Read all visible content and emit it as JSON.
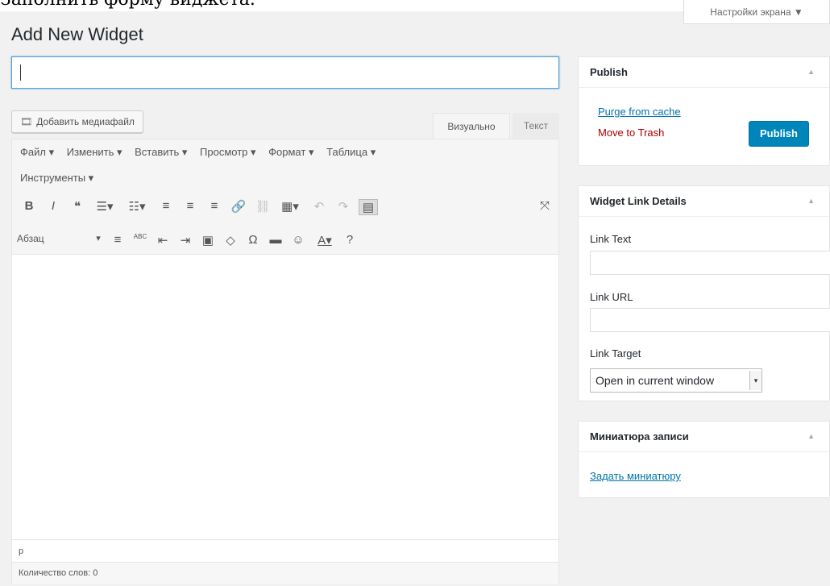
{
  "caption": "Заполнить форму виджета.",
  "screen_options": "Настройки экрана ▼",
  "page_title": "Add New Widget",
  "title_field": {
    "value": "",
    "placeholder": ""
  },
  "media_button": {
    "icon": "media-icon",
    "label": "Добавить медиафайл"
  },
  "editor_tabs": {
    "visual": "Визуально",
    "text": "Текст"
  },
  "menubar": {
    "row1": [
      "Файл ▾",
      "Изменить ▾",
      "Вставить ▾",
      "Просмотр ▾",
      "Формат ▾",
      "Таблица ▾"
    ],
    "row2": [
      "Инструменты ▾"
    ]
  },
  "toolbar1": [
    "B",
    "I",
    "❝",
    "☰▾",
    "☷▾",
    "≡",
    "≡",
    "≡",
    "🔗",
    "⛓",
    "▦▾",
    "↶",
    "↷",
    "▤",
    "⤧"
  ],
  "toolbar2": {
    "format_select": "Абзац",
    "buttons": [
      "▾",
      "≡",
      "ABC",
      "⇤",
      "⇥",
      "▣",
      "◇",
      "Ω",
      "▬",
      "☺",
      "A▾",
      "?"
    ]
  },
  "status_path": "p",
  "word_count": "Количество слов: 0",
  "publish_box": {
    "title": "Publish",
    "toggle": "▲",
    "purge": "Purge from cache",
    "trash": "Move to Trash",
    "publish": "Publish"
  },
  "link_box": {
    "title": "Widget Link Details",
    "toggle": "▲",
    "link_text_label": "Link Text",
    "link_url_label": "Link URL",
    "link_target_label": "Link Target",
    "link_target_value": "Open in current window"
  },
  "thumb_box": {
    "title": "Миниатюра записи",
    "toggle": "▲",
    "set_link": "Задать миниатюру"
  }
}
